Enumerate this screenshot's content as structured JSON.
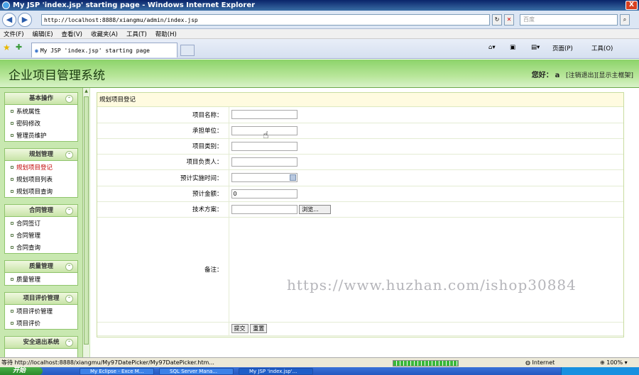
{
  "window": {
    "title": "My JSP 'index.jsp' starting page - Windows Internet Explorer",
    "close_label": "X"
  },
  "browser": {
    "address": "http://localhost:8888/xiangmu/admin/index.jsp",
    "search_placeholder": "百度",
    "menu": [
      "文件(F)",
      "编辑(E)",
      "查看(V)",
      "收藏夹(A)",
      "工具(T)",
      "帮助(H)"
    ],
    "tab_title": "My JSP 'index.jsp' starting page",
    "toolbar": {
      "page_label": "页面(P)",
      "tools_label": "工具(O)"
    }
  },
  "header": {
    "system_title": "企业项目管理系统",
    "greeting": "您好：",
    "username": "a",
    "links": "[注销退出][显示主框架]"
  },
  "sidebar": {
    "panels": [
      {
        "title": "基本操作",
        "items": [
          "系统属性",
          "密码修改",
          "管理员维护"
        ]
      },
      {
        "title": "规划管理",
        "items": [
          "规划项目登记",
          "规划项目列表",
          "规划项目查询"
        ]
      },
      {
        "title": "合同管理",
        "items": [
          "合同签订",
          "合同管理",
          "合同查询"
        ]
      },
      {
        "title": "质量管理",
        "items": [
          "质量管理"
        ]
      },
      {
        "title": "项目评价管理",
        "items": [
          "项目评价管理",
          "项目评价"
        ]
      },
      {
        "title": "安全退出系统",
        "items": []
      }
    ]
  },
  "form": {
    "title": "规划项目登记",
    "fields": [
      {
        "label": "项目名称：",
        "value": ""
      },
      {
        "label": "承担单位：",
        "value": ""
      },
      {
        "label": "项目类别：",
        "value": ""
      },
      {
        "label": "项目负责人：",
        "value": ""
      },
      {
        "label": "预计实施时间：",
        "value": ""
      },
      {
        "label": "预计金额：",
        "value": "0"
      },
      {
        "label": "技术方案：",
        "value": ""
      }
    ],
    "browse_label": "浏览...",
    "remark_label": "备注：",
    "submit_label": "提交",
    "reset_label": "重置"
  },
  "watermark": "https://www.huzhan.com/ishop30884",
  "status": {
    "text": "等待 http://localhost:8888/xiangmu/My97DatePicker/My97DatePicker.htm...",
    "zone": "Internet",
    "zoom": "100%"
  },
  "taskbar": {
    "start_label": "开始",
    "items": [
      "My Eclipse - Exce M...",
      "SQL Server Mana...",
      "My JSP 'index.jsp'..."
    ]
  }
}
